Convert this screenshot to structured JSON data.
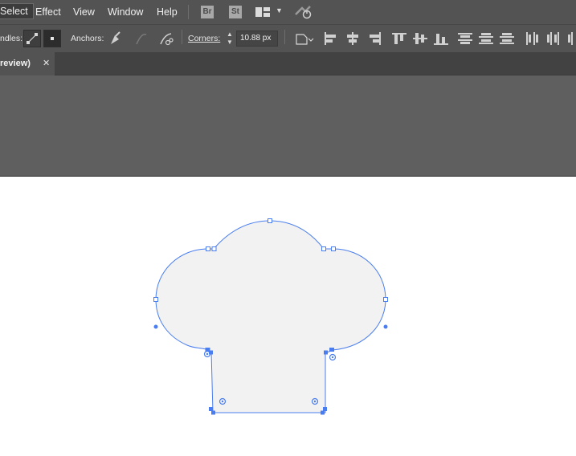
{
  "menu": {
    "items": [
      "Select",
      "Effect",
      "View",
      "Window",
      "Help"
    ],
    "bridge_label": "Br",
    "stock_label": "St"
  },
  "control": {
    "handles_label": "ndles:",
    "anchors_label": "Anchors:",
    "corners_label": "Corners:",
    "corners_value": "10.88 px"
  },
  "tab": {
    "title": "review)",
    "close": "✕"
  },
  "icons": {
    "workspace": "workspace-switcher-icon",
    "gpu": "gpu-performance-icon",
    "convert_corner": "convert-to-corner-icon",
    "convert_smooth": "convert-to-smooth-icon",
    "pen": "pen-icon",
    "cut_path": "cut-path-icon"
  },
  "colors": {
    "selection": "#4a7ef0",
    "shape_fill": "#f2f2f2",
    "ui_dark": "#535353",
    "pasteboard": "#5f5f5f"
  }
}
